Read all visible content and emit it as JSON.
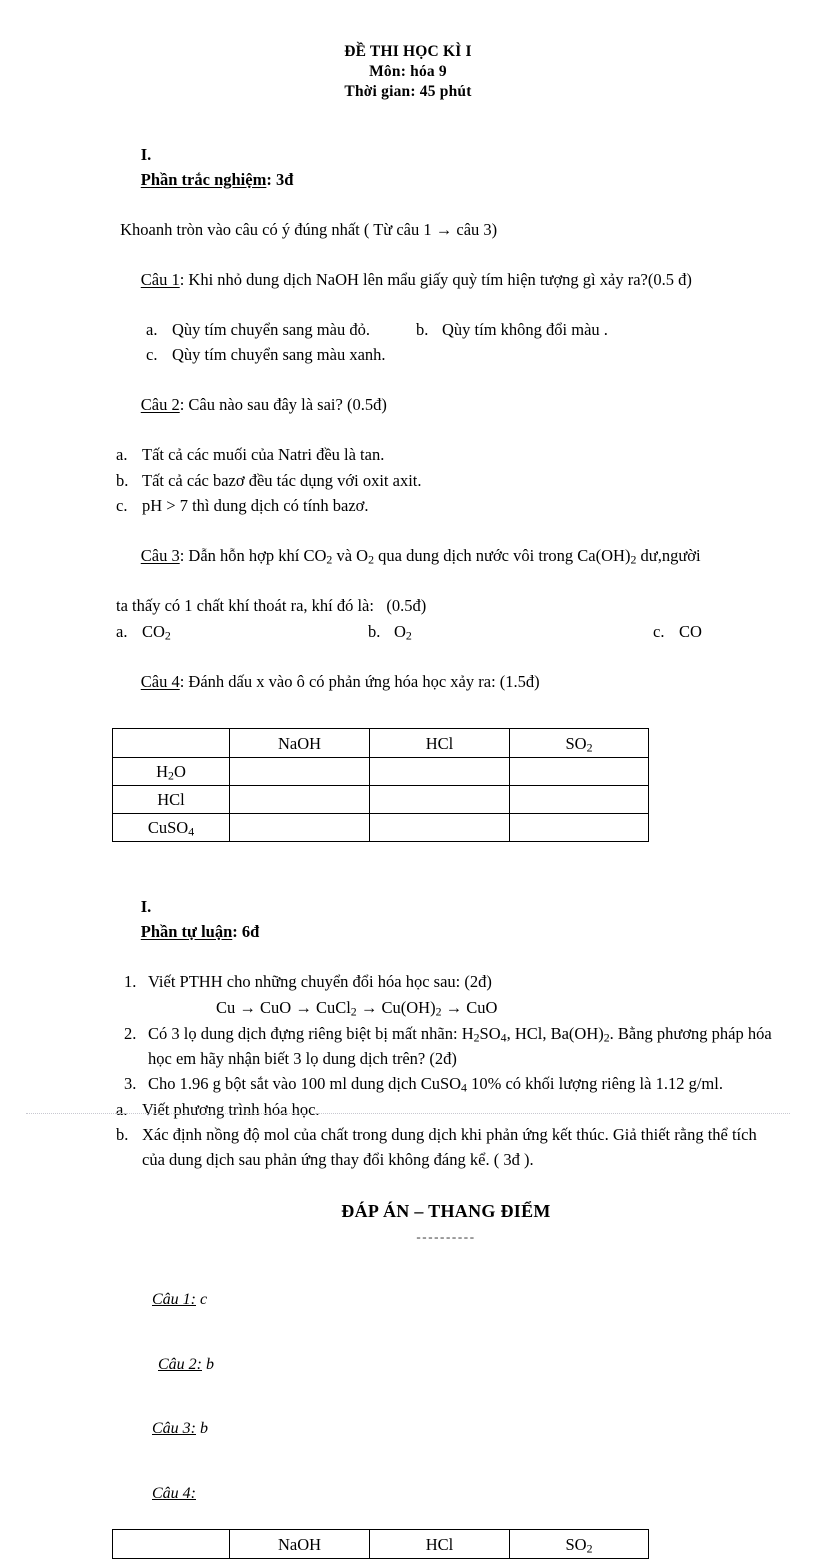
{
  "header": {
    "title": "ĐỀ THI HỌC KÌ I",
    "subject": "Môn: hóa 9",
    "duration": "Thời gian: 45 phút"
  },
  "section1": {
    "roman": "I.",
    "heading": "Phần trắc nghiệm",
    "points": ": 3đ",
    "instruction": " Khoanh tròn vào câu có ý đúng nhất ( Từ câu 1 → câu 3)",
    "q1": {
      "label": "Câu 1",
      "text": ": Khi nhỏ dung dịch NaOH lên mẩu giấy quỳ tím hiện tượng gì xảy ra?(0.5 đ)",
      "opt_a_letter": "a.",
      "opt_a": "Qùy tím chuyển sang màu đỏ.",
      "opt_b_letter": "b.",
      "opt_b": "Qùy tím không đổi màu .",
      "opt_c_letter": "c.",
      "opt_c": "Qùy tím chuyển sang màu xanh."
    },
    "q2": {
      "label": "Câu 2",
      "text": ": Câu nào sau đây là sai? (0.5đ)",
      "opt_a_letter": "a.",
      "opt_a": "Tất cả các muối của Natri đều là tan.",
      "opt_b_letter": "b.",
      "opt_b": "Tất cả các bazơ đều tác dụng với oxit axit.",
      "opt_c_letter": "c.",
      "opt_c": "pH > 7 thì dung dịch có tính bazơ."
    },
    "q3": {
      "label": "Câu 3",
      "text_line1_pre": ": Dẫn hỗn hợp khí CO",
      "text_line1_mid": " và O",
      "text_line1_mid2": " qua dung dịch nước vôi trong Ca(OH)",
      "text_line1_end": " dư,người",
      "text_line2": "ta thấy có 1 chất khí thoát ra, khí đó là:   (0.5đ)",
      "opt_a_letter": "a.",
      "opt_a": "CO",
      "opt_a_sub": "2",
      "opt_b_letter": "b.",
      "opt_b": "O",
      "opt_b_sub": "2",
      "opt_c_letter": "c.",
      "opt_c": "CO"
    },
    "q4": {
      "label": "Câu 4",
      "text": ": Đánh dấu x vào ô có phản ứng hóa học xảy ra: (1.5đ)",
      "table": {
        "corner": "",
        "columns": [
          "NaOH",
          "HCl",
          "SO2"
        ],
        "columns_display": [
          {
            "base": "NaOH",
            "sub": ""
          },
          {
            "base": "HCl",
            "sub": ""
          },
          {
            "base": "SO",
            "sub": "2"
          }
        ],
        "rows": [
          {
            "label_base": "H",
            "label_sub": "2",
            "label_post": "O",
            "cells": [
              "",
              "",
              ""
            ]
          },
          {
            "label_base": "HCl",
            "label_sub": "",
            "label_post": "",
            "cells": [
              "",
              "",
              ""
            ]
          },
          {
            "label_base": "CuSO",
            "label_sub": "4",
            "label_post": "",
            "cells": [
              "",
              "",
              ""
            ]
          }
        ]
      }
    }
  },
  "section2": {
    "roman": "I.",
    "heading": "Phần tự luận",
    "points": ": 6đ",
    "item1": {
      "num": "1.",
      "text": "Viết PTHH cho những chuyển đổi hóa học sau: (2đ)",
      "chain_parts": [
        {
          "base": "Cu",
          "sub": ""
        },
        {
          "base": "CuO",
          "sub": ""
        },
        {
          "base": "CuCl",
          "sub": "2"
        },
        {
          "base": "Cu(OH)",
          "sub": "2"
        },
        {
          "base": "CuO",
          "sub": ""
        }
      ],
      "arrow": "→"
    },
    "item2": {
      "num": "2.",
      "line1_a": "Có  3 lọ dung dịch đựng riêng biệt bị mất nhãn: H",
      "line1_b": "SO",
      "line1_c": ", HCl, Ba(OH)",
      "line1_d": ". Bằng",
      "line2": "phương pháp hóa học em hãy nhận biết 3 lọ dung dịch trên? (2đ)"
    },
    "item3": {
      "num": "3.",
      "line1_a": "Cho 1.96 g bột sắt vào 100 ml dung dịch CuSO",
      "line1_b": " 10% có khối lượng riêng là 1.12",
      "line2": "g/ml."
    },
    "item3a": {
      "mark": "a.",
      "text": "Viết phương trình hóa học."
    },
    "item3b": {
      "mark": "b.",
      "line1": "Xác định nồng độ mol của chất trong dung dịch khi phản ứng kết thúc. Giả thiết",
      "line2": "rằng thể tích của dung dịch sau phản ứng thay đổi không đáng kể. ( 3đ )."
    }
  },
  "answer_key": {
    "title": "ĐÁP ÁN – THANG ĐIỂM",
    "dashes": "----------",
    "items": [
      {
        "label": "Câu 1:",
        "value": " c"
      },
      {
        "label": "Câu 2:",
        "value": " b"
      },
      {
        "label": "Câu 3:",
        "value": " b"
      },
      {
        "label": "Câu 4:",
        "value": ""
      }
    ],
    "table": {
      "corner": "",
      "columns_display": [
        {
          "base": "NaOH",
          "sub": ""
        },
        {
          "base": "HCl",
          "sub": ""
        },
        {
          "base": "SO",
          "sub": "2"
        }
      ]
    }
  }
}
